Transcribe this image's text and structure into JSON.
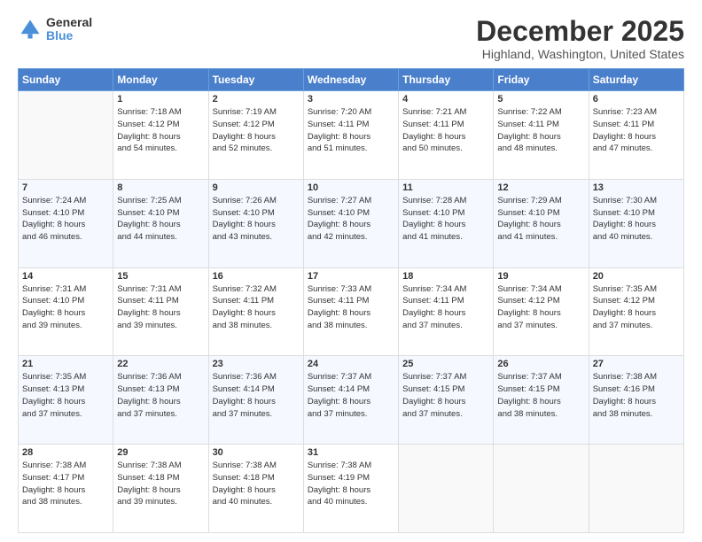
{
  "header": {
    "logo_general": "General",
    "logo_blue": "Blue",
    "title": "December 2025",
    "subtitle": "Highland, Washington, United States"
  },
  "calendar": {
    "headers": [
      "Sunday",
      "Monday",
      "Tuesday",
      "Wednesday",
      "Thursday",
      "Friday",
      "Saturday"
    ],
    "rows": [
      [
        {
          "day": "",
          "info": ""
        },
        {
          "day": "1",
          "info": "Sunrise: 7:18 AM\nSunset: 4:12 PM\nDaylight: 8 hours\nand 54 minutes."
        },
        {
          "day": "2",
          "info": "Sunrise: 7:19 AM\nSunset: 4:12 PM\nDaylight: 8 hours\nand 52 minutes."
        },
        {
          "day": "3",
          "info": "Sunrise: 7:20 AM\nSunset: 4:11 PM\nDaylight: 8 hours\nand 51 minutes."
        },
        {
          "day": "4",
          "info": "Sunrise: 7:21 AM\nSunset: 4:11 PM\nDaylight: 8 hours\nand 50 minutes."
        },
        {
          "day": "5",
          "info": "Sunrise: 7:22 AM\nSunset: 4:11 PM\nDaylight: 8 hours\nand 48 minutes."
        },
        {
          "day": "6",
          "info": "Sunrise: 7:23 AM\nSunset: 4:11 PM\nDaylight: 8 hours\nand 47 minutes."
        }
      ],
      [
        {
          "day": "7",
          "info": "Sunrise: 7:24 AM\nSunset: 4:10 PM\nDaylight: 8 hours\nand 46 minutes."
        },
        {
          "day": "8",
          "info": "Sunrise: 7:25 AM\nSunset: 4:10 PM\nDaylight: 8 hours\nand 44 minutes."
        },
        {
          "day": "9",
          "info": "Sunrise: 7:26 AM\nSunset: 4:10 PM\nDaylight: 8 hours\nand 43 minutes."
        },
        {
          "day": "10",
          "info": "Sunrise: 7:27 AM\nSunset: 4:10 PM\nDaylight: 8 hours\nand 42 minutes."
        },
        {
          "day": "11",
          "info": "Sunrise: 7:28 AM\nSunset: 4:10 PM\nDaylight: 8 hours\nand 41 minutes."
        },
        {
          "day": "12",
          "info": "Sunrise: 7:29 AM\nSunset: 4:10 PM\nDaylight: 8 hours\nand 41 minutes."
        },
        {
          "day": "13",
          "info": "Sunrise: 7:30 AM\nSunset: 4:10 PM\nDaylight: 8 hours\nand 40 minutes."
        }
      ],
      [
        {
          "day": "14",
          "info": "Sunrise: 7:31 AM\nSunset: 4:10 PM\nDaylight: 8 hours\nand 39 minutes."
        },
        {
          "day": "15",
          "info": "Sunrise: 7:31 AM\nSunset: 4:11 PM\nDaylight: 8 hours\nand 39 minutes."
        },
        {
          "day": "16",
          "info": "Sunrise: 7:32 AM\nSunset: 4:11 PM\nDaylight: 8 hours\nand 38 minutes."
        },
        {
          "day": "17",
          "info": "Sunrise: 7:33 AM\nSunset: 4:11 PM\nDaylight: 8 hours\nand 38 minutes."
        },
        {
          "day": "18",
          "info": "Sunrise: 7:34 AM\nSunset: 4:11 PM\nDaylight: 8 hours\nand 37 minutes."
        },
        {
          "day": "19",
          "info": "Sunrise: 7:34 AM\nSunset: 4:12 PM\nDaylight: 8 hours\nand 37 minutes."
        },
        {
          "day": "20",
          "info": "Sunrise: 7:35 AM\nSunset: 4:12 PM\nDaylight: 8 hours\nand 37 minutes."
        }
      ],
      [
        {
          "day": "21",
          "info": "Sunrise: 7:35 AM\nSunset: 4:13 PM\nDaylight: 8 hours\nand 37 minutes."
        },
        {
          "day": "22",
          "info": "Sunrise: 7:36 AM\nSunset: 4:13 PM\nDaylight: 8 hours\nand 37 minutes."
        },
        {
          "day": "23",
          "info": "Sunrise: 7:36 AM\nSunset: 4:14 PM\nDaylight: 8 hours\nand 37 minutes."
        },
        {
          "day": "24",
          "info": "Sunrise: 7:37 AM\nSunset: 4:14 PM\nDaylight: 8 hours\nand 37 minutes."
        },
        {
          "day": "25",
          "info": "Sunrise: 7:37 AM\nSunset: 4:15 PM\nDaylight: 8 hours\nand 37 minutes."
        },
        {
          "day": "26",
          "info": "Sunrise: 7:37 AM\nSunset: 4:15 PM\nDaylight: 8 hours\nand 38 minutes."
        },
        {
          "day": "27",
          "info": "Sunrise: 7:38 AM\nSunset: 4:16 PM\nDaylight: 8 hours\nand 38 minutes."
        }
      ],
      [
        {
          "day": "28",
          "info": "Sunrise: 7:38 AM\nSunset: 4:17 PM\nDaylight: 8 hours\nand 38 minutes."
        },
        {
          "day": "29",
          "info": "Sunrise: 7:38 AM\nSunset: 4:18 PM\nDaylight: 8 hours\nand 39 minutes."
        },
        {
          "day": "30",
          "info": "Sunrise: 7:38 AM\nSunset: 4:18 PM\nDaylight: 8 hours\nand 40 minutes."
        },
        {
          "day": "31",
          "info": "Sunrise: 7:38 AM\nSunset: 4:19 PM\nDaylight: 8 hours\nand 40 minutes."
        },
        {
          "day": "",
          "info": ""
        },
        {
          "day": "",
          "info": ""
        },
        {
          "day": "",
          "info": ""
        }
      ]
    ]
  }
}
